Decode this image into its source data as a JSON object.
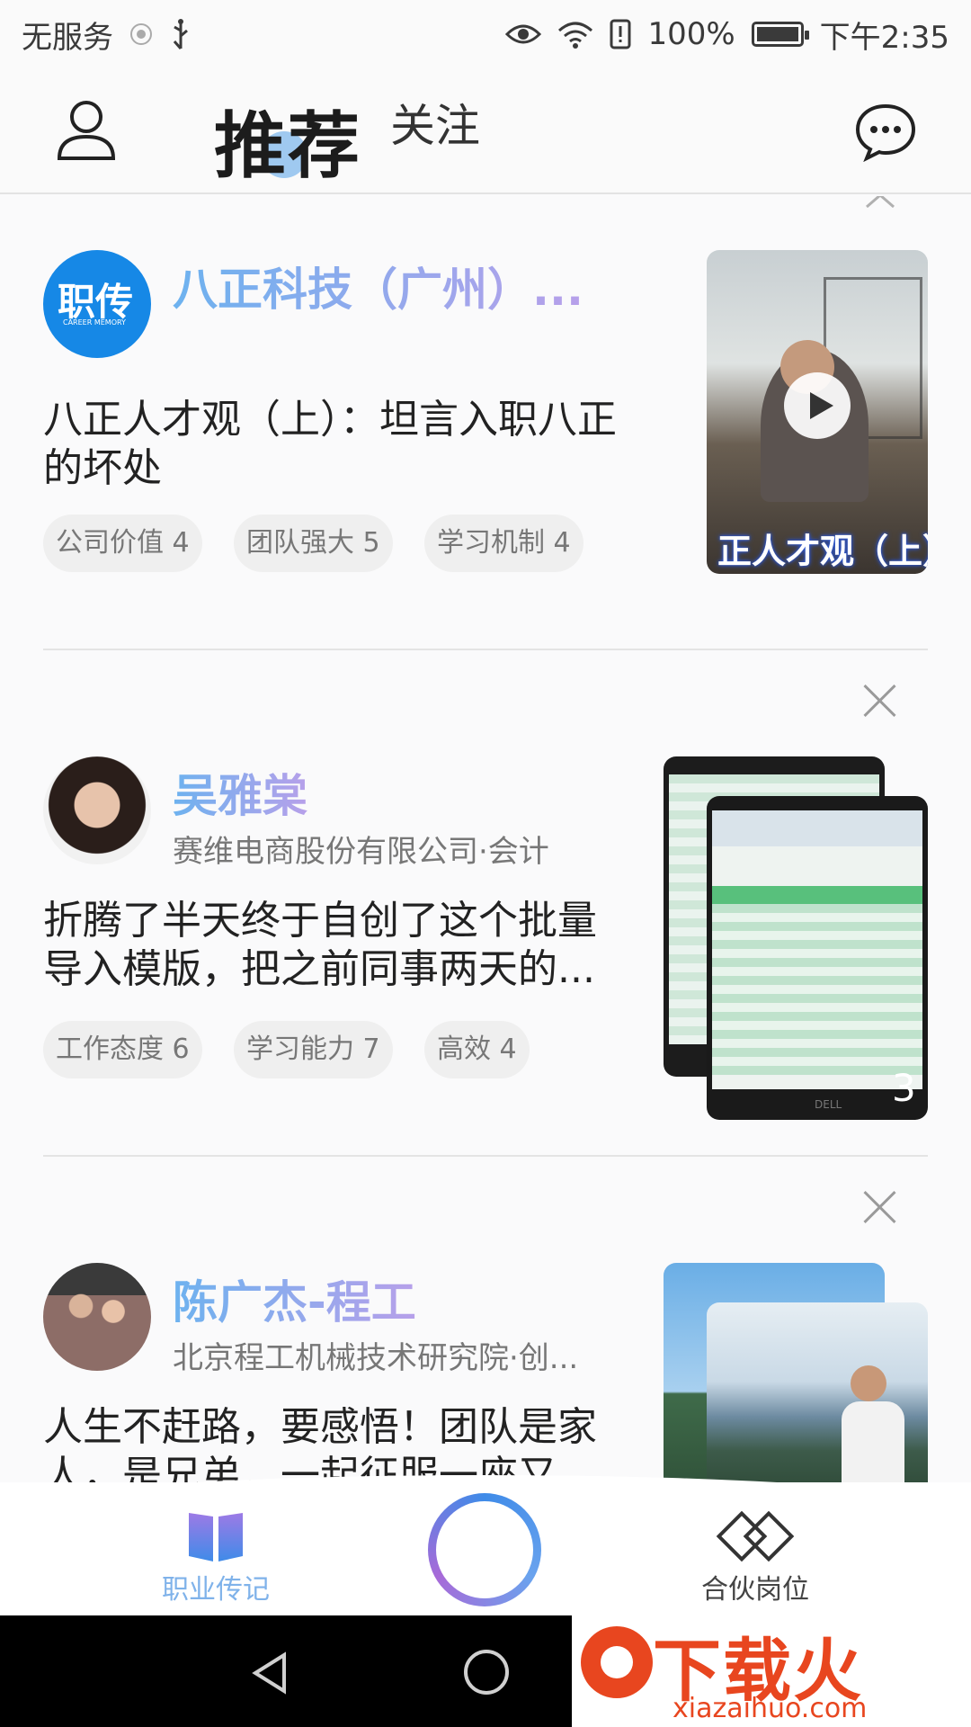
{
  "status": {
    "carrier": "无服务",
    "battery": "100%",
    "time": "下午2:35"
  },
  "header": {
    "tab_recommend": "推荐",
    "tab_follow": "关注"
  },
  "feed": [
    {
      "author": "八正科技（广州）...",
      "logo_text": "职传",
      "logo_sub": "CAREER MEMORY",
      "title": "八正人才观（上）：坦言入职八正的坏处",
      "tags": [
        "公司价值 4",
        "团队强大 5",
        "学习机制 4"
      ],
      "video_caption": "正人才观（上）"
    },
    {
      "author": "吴雅棠",
      "subtitle": "赛维电商股份有限公司·会计",
      "title": "折腾了半天终于自创了这个批量导入模版，把之前同事两天的...",
      "tags": [
        "工作态度 6",
        "学习能力 7",
        "高效 4"
      ],
      "image_count": "3",
      "monitor_brand": "DELL"
    },
    {
      "author": "陈广杰-程工",
      "subtitle": "北京程工机械技术研究院·创...",
      "title": "人生不赶路，要感悟！团队是家人，是兄弟，一起征服一座又"
    }
  ],
  "tabbar": {
    "left_label": "职业传记",
    "right_label": "合伙岗位"
  },
  "watermark": {
    "text": "下载火",
    "url": "xiazaihuo.com"
  },
  "colors": {
    "accent_blue": "#3f8be8",
    "accent_purple": "#a76ad8"
  }
}
